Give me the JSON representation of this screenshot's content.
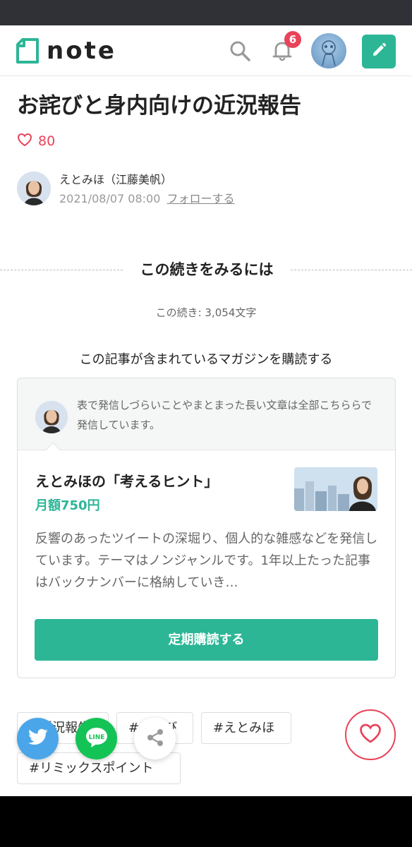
{
  "header": {
    "logo_text": "note",
    "notification_count": "6",
    "icons": [
      "note-logo-icon",
      "search-icon",
      "bell-icon",
      "user-avatar",
      "pencil-icon"
    ]
  },
  "article": {
    "title": "お詫びと身内向けの近況報告",
    "like_count": "80",
    "author_name": "えとみほ（江藤美帆）",
    "published_at": "2021/08/07 08:00",
    "follow_label": "フォローする"
  },
  "paywall": {
    "heading": "この続きをみるには",
    "remaining_text": "この続き: 3,054文字",
    "subscribe_heading": "この記事が含まれているマガジンを購読する"
  },
  "magazine": {
    "author_message": "表で発信しづらいことやまとまった長い文章は全部こちららで発信しています。",
    "title": "えとみほの「考えるヒント」",
    "price": "月額750円",
    "description": "反響のあったツイートの深堀り、個人的な雑感などを発信しています。テーマはノンジャンルです。1年以上たった記事はバックナンバーに格納していき…",
    "button_label": "定期購読する"
  },
  "tags": [
    "#近況報告",
    "#お詫び",
    "#えとみほ",
    "#リミックスポイント"
  ],
  "share": {
    "line_label": "LINE"
  },
  "colors": {
    "brand_green": "#2cb696",
    "like_red": "#e8435a",
    "twitter_blue": "#4aa6e9",
    "line_green": "#14c355",
    "status_bar": "#2f3136"
  }
}
